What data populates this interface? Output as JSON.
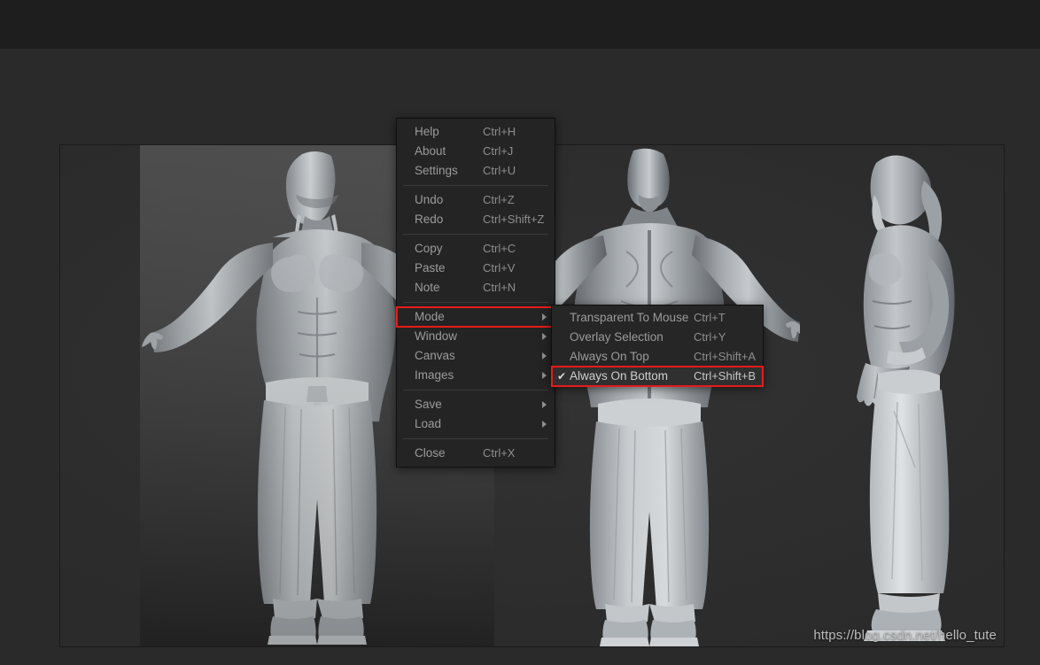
{
  "app": {
    "background_color": "#2a2a2a",
    "top_bar_color": "#1e1e1e",
    "canvas_color": "#2e2e2e",
    "accent_annotation_color": "#e81a1a"
  },
  "viewport": {
    "name": "3d-sculpt-viewport",
    "figures": [
      {
        "name": "front-view-character",
        "pose": "front, arms out, bald with beard, bare torso, hakama trousers and boots"
      },
      {
        "name": "back-view-character",
        "pose": "back, arms out, muscular back, hakama trousers and boots"
      },
      {
        "name": "side-view-character",
        "pose": "left profile, hands behind back, long hair and beard"
      }
    ]
  },
  "watermark": {
    "text": "https://blog.csdn.net/hello_tute"
  },
  "context_menu": {
    "name": "main-context-menu",
    "groups": [
      {
        "items": [
          {
            "label": "Help",
            "accel": "Ctrl+H",
            "submenu": false,
            "annotated": false
          },
          {
            "label": "About",
            "accel": "Ctrl+J",
            "submenu": false,
            "annotated": false
          },
          {
            "label": "Settings",
            "accel": "Ctrl+U",
            "submenu": false,
            "annotated": false
          }
        ]
      },
      {
        "items": [
          {
            "label": "Undo",
            "accel": "Ctrl+Z",
            "submenu": false,
            "annotated": false
          },
          {
            "label": "Redo",
            "accel": "Ctrl+Shift+Z",
            "submenu": false,
            "annotated": false
          }
        ]
      },
      {
        "items": [
          {
            "label": "Copy",
            "accel": "Ctrl+C",
            "submenu": false,
            "annotated": false
          },
          {
            "label": "Paste",
            "accel": "Ctrl+V",
            "submenu": false,
            "annotated": false
          },
          {
            "label": "Note",
            "accel": "Ctrl+N",
            "submenu": false,
            "annotated": false
          }
        ]
      },
      {
        "items": [
          {
            "label": "Mode",
            "accel": "",
            "submenu": true,
            "annotated": true
          },
          {
            "label": "Window",
            "accel": "",
            "submenu": true,
            "annotated": false
          },
          {
            "label": "Canvas",
            "accel": "",
            "submenu": true,
            "annotated": false
          },
          {
            "label": "Images",
            "accel": "",
            "submenu": true,
            "annotated": false
          }
        ]
      },
      {
        "items": [
          {
            "label": "Save",
            "accel": "",
            "submenu": true,
            "annotated": false
          },
          {
            "label": "Load",
            "accel": "",
            "submenu": true,
            "annotated": false
          }
        ]
      },
      {
        "items": [
          {
            "label": "Close",
            "accel": "Ctrl+X",
            "submenu": false,
            "annotated": false
          }
        ]
      }
    ]
  },
  "mode_submenu": {
    "name": "mode-submenu",
    "parent_item": "Mode",
    "check_glyph": "✔",
    "items": [
      {
        "label": "Transparent To Mouse",
        "accel": "Ctrl+T",
        "checked": false,
        "annotated": false
      },
      {
        "label": "Overlay Selection",
        "accel": "Ctrl+Y",
        "checked": false,
        "annotated": false
      },
      {
        "label": "Always On Top",
        "accel": "Ctrl+Shift+A",
        "checked": false,
        "annotated": false
      },
      {
        "label": "Always On Bottom",
        "accel": "Ctrl+Shift+B",
        "checked": true,
        "annotated": true
      }
    ]
  }
}
